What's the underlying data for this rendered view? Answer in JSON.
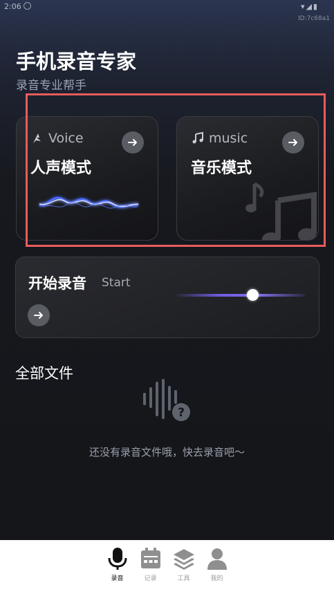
{
  "status_bar": {
    "time": "2:06",
    "device_id": "ID:7c68a1"
  },
  "header": {
    "title": "手机录音专家",
    "subtitle": "录音专业帮手"
  },
  "mode_cards": [
    {
      "tag": "Voice",
      "name": "人声模式",
      "icon": "voice-feather-icon"
    },
    {
      "tag": "music",
      "name": "音乐模式",
      "icon": "music-note-icon"
    }
  ],
  "start_card": {
    "title": "开始录音",
    "subtitle": "Start",
    "slider_level": 0.6
  },
  "files": {
    "title": "全部文件",
    "empty_message": "还没有录音文件哦，快去录音吧～"
  },
  "bottom_nav": [
    {
      "label": "录音",
      "icon": "microphone-icon",
      "active": true
    },
    {
      "label": "记录",
      "icon": "calendar-icon",
      "active": false
    },
    {
      "label": "工具",
      "icon": "layers-icon",
      "active": false
    },
    {
      "label": "我的",
      "icon": "user-icon",
      "active": false
    }
  ],
  "colors": {
    "highlight": "#e85c5c",
    "accent": "#6d5ce0"
  }
}
